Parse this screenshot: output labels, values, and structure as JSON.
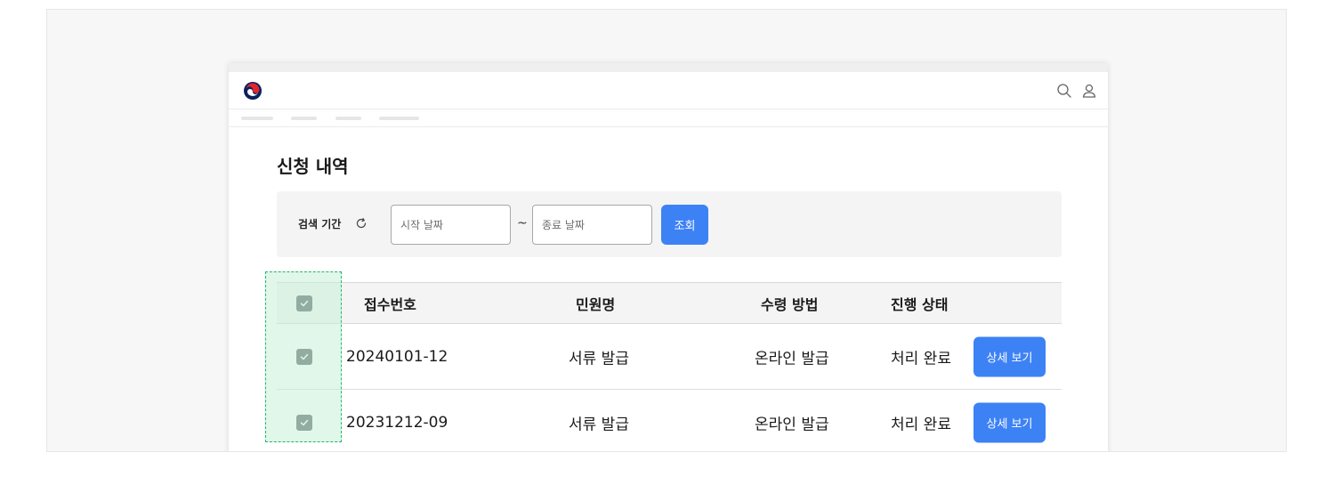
{
  "page": {
    "title": "신청 내역"
  },
  "filter": {
    "label": "검색 기간",
    "start_placeholder": "시작 날짜",
    "separator": "~",
    "end_placeholder": "종료 날짜",
    "search_label": "조회"
  },
  "table": {
    "columns": [
      "접수번호",
      "민원명",
      "수령 방법",
      "진행 상태"
    ],
    "rows": [
      {
        "id": "20240101-12",
        "name": "서류 발급",
        "method": "온라인 발급",
        "status": "처리 완료",
        "action": "상세 보기",
        "checked": true
      },
      {
        "id": "20231212-09",
        "name": "서류 발급",
        "method": "온라인 발급",
        "status": "처리 완료",
        "action": "상세 보기",
        "checked": true
      }
    ],
    "header_checked": true
  },
  "colors": {
    "accent": "#3d82f5",
    "checkbox": "#555a60",
    "highlight_border": "#25b86a",
    "highlight_fill": "#c7f0d8"
  },
  "icons": {
    "logo": "taegeuk-logo-icon",
    "search": "search-icon",
    "user": "user-icon",
    "refresh": "refresh-icon",
    "check": "check-icon"
  }
}
